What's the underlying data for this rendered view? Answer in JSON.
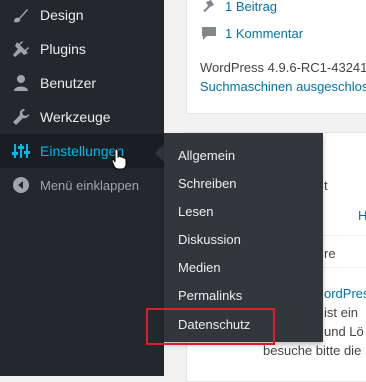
{
  "sidebar": {
    "items": [
      {
        "label": "Design",
        "icon": "brush-icon"
      },
      {
        "label": "Plugins",
        "icon": "plug-icon"
      },
      {
        "label": "Benutzer",
        "icon": "user-icon"
      },
      {
        "label": "Werkzeuge",
        "icon": "wrench-icon"
      },
      {
        "label": "Einstellungen",
        "icon": "settings-sliders-icon",
        "active": true
      },
      {
        "label": "Menü einklappen",
        "icon": "collapse-arrow-icon"
      }
    ]
  },
  "flyout": {
    "items": [
      "Allgemein",
      "Schreiben",
      "Lesen",
      "Diskussion",
      "Medien",
      "Permalinks",
      "Datenschutz"
    ],
    "highlighted": "Datenschutz"
  },
  "glance": {
    "beitrag": "1 Beitrag",
    "kommentar": "1 Kommentar",
    "version": "WordPress 4.9.6-RC1-43241",
    "search_engines": "Suchmaschinen ausgeschloss"
  },
  "second_card": {
    "partial_1": "t",
    "partial_2": "H",
    "partial_3": "re",
    "wp_link": "ordPress",
    "line_1": "ist ein",
    "line_2": "und Lö",
    "line_3": "besuche bitte die"
  },
  "colors": {
    "sidebar_bg": "#23282d",
    "flyout_bg": "#32373c",
    "active_text": "#00b9eb",
    "link": "#0073aa",
    "highlight_box": "#dc1e2a"
  }
}
